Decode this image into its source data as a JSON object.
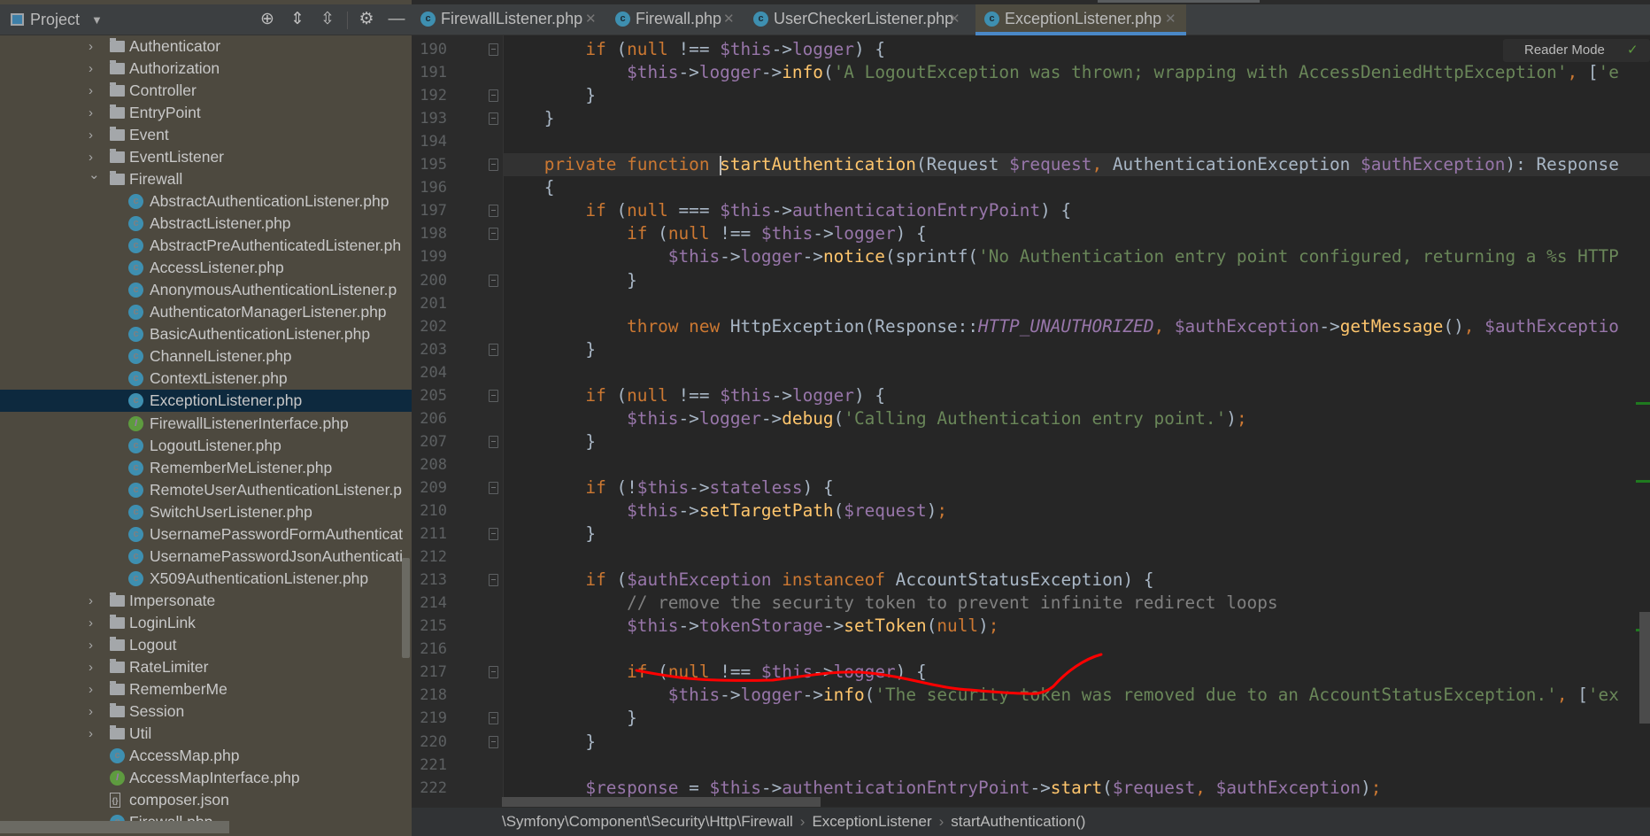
{
  "sidebar": {
    "title": "Project",
    "tree": [
      {
        "type": "folder",
        "open": false,
        "level": 1,
        "label": "Authenticator"
      },
      {
        "type": "folder",
        "open": false,
        "level": 1,
        "label": "Authorization"
      },
      {
        "type": "folder",
        "open": false,
        "level": 1,
        "label": "Controller"
      },
      {
        "type": "folder",
        "open": false,
        "level": 1,
        "label": "EntryPoint"
      },
      {
        "type": "folder",
        "open": false,
        "level": 1,
        "label": "Event"
      },
      {
        "type": "folder",
        "open": false,
        "level": 1,
        "label": "EventListener"
      },
      {
        "type": "folder",
        "open": true,
        "level": 1,
        "label": "Firewall"
      },
      {
        "type": "abstract",
        "level": 2,
        "label": "AbstractAuthenticationListener.php"
      },
      {
        "type": "abstract",
        "level": 2,
        "label": "AbstractListener.php"
      },
      {
        "type": "abstract",
        "level": 2,
        "label": "AbstractPreAuthenticatedListener.ph"
      },
      {
        "type": "class",
        "level": 2,
        "label": "AccessListener.php"
      },
      {
        "type": "class",
        "level": 2,
        "label": "AnonymousAuthenticationListener.p"
      },
      {
        "type": "class",
        "level": 2,
        "label": "AuthenticatorManagerListener.php"
      },
      {
        "type": "class",
        "level": 2,
        "label": "BasicAuthenticationListener.php"
      },
      {
        "type": "class",
        "level": 2,
        "label": "ChannelListener.php"
      },
      {
        "type": "class",
        "level": 2,
        "label": "ContextListener.php"
      },
      {
        "type": "class",
        "level": 2,
        "label": "ExceptionListener.php",
        "selected": true
      },
      {
        "type": "interface",
        "level": 2,
        "label": "FirewallListenerInterface.php"
      },
      {
        "type": "class",
        "level": 2,
        "label": "LogoutListener.php"
      },
      {
        "type": "class",
        "level": 2,
        "label": "RememberMeListener.php"
      },
      {
        "type": "class",
        "level": 2,
        "label": "RemoteUserAuthenticationListener.p"
      },
      {
        "type": "class",
        "level": 2,
        "label": "SwitchUserListener.php"
      },
      {
        "type": "class",
        "level": 2,
        "label": "UsernamePasswordFormAuthenticat"
      },
      {
        "type": "class",
        "level": 2,
        "label": "UsernamePasswordJsonAuthenticati"
      },
      {
        "type": "class",
        "level": 2,
        "label": "X509AuthenticationListener.php"
      },
      {
        "type": "folder",
        "open": false,
        "level": 1,
        "label": "Impersonate"
      },
      {
        "type": "folder",
        "open": false,
        "level": 1,
        "label": "LoginLink"
      },
      {
        "type": "folder",
        "open": false,
        "level": 1,
        "label": "Logout"
      },
      {
        "type": "folder",
        "open": false,
        "level": 1,
        "label": "RateLimiter"
      },
      {
        "type": "folder",
        "open": false,
        "level": 1,
        "label": "RememberMe"
      },
      {
        "type": "folder",
        "open": false,
        "level": 1,
        "label": "Session"
      },
      {
        "type": "folder",
        "open": false,
        "level": 1,
        "label": "Util"
      },
      {
        "type": "class",
        "level": 1,
        "label": "AccessMap.php"
      },
      {
        "type": "interface",
        "level": 1,
        "label": "AccessMapInterface.php"
      },
      {
        "type": "json",
        "level": 1,
        "label": "composer.json"
      },
      {
        "type": "class",
        "level": 1,
        "label": "Firewall.php"
      }
    ]
  },
  "tabs": [
    {
      "label": "FirewallListener.php",
      "active": false
    },
    {
      "label": "Firewall.php",
      "active": false
    },
    {
      "label": "UserCheckerListener.php",
      "active": false
    },
    {
      "label": "ExceptionListener.php",
      "active": true
    }
  ],
  "editor": {
    "reader_mode": "Reader Mode",
    "current_line": 195,
    "lines": [
      {
        "n": "190",
        "fold": "open",
        "t": [
          [
            "d",
            "        "
          ],
          [
            "k",
            "if"
          ],
          [
            "d",
            " ("
          ],
          [
            "k",
            "null"
          ],
          [
            "d",
            " !== "
          ],
          [
            "v",
            "$this"
          ],
          [
            "d",
            "->"
          ],
          [
            "v",
            "logger"
          ],
          [
            "d",
            ") {"
          ]
        ]
      },
      {
        "n": "191",
        "t": [
          [
            "d",
            "            "
          ],
          [
            "v",
            "$this"
          ],
          [
            "d",
            "->"
          ],
          [
            "v",
            "logger"
          ],
          [
            "d",
            "->"
          ],
          [
            "m",
            "info"
          ],
          [
            "d",
            "("
          ],
          [
            "s",
            "'A LogoutException was thrown; wrapping with AccessDeniedHttpException'"
          ],
          [
            "k",
            ","
          ],
          [
            "d",
            " ["
          ],
          [
            "s",
            "'e"
          ]
        ]
      },
      {
        "n": "192",
        "fold": "close",
        "t": [
          [
            "d",
            "        }"
          ]
        ]
      },
      {
        "n": "193",
        "fold": "close",
        "t": [
          [
            "d",
            "    }"
          ]
        ]
      },
      {
        "n": "194",
        "t": []
      },
      {
        "n": "195",
        "fold": "open",
        "t": [
          [
            "d",
            "    "
          ],
          [
            "k",
            "private function "
          ],
          [
            "caret",
            ""
          ],
          [
            "m",
            "startAuthentication"
          ],
          [
            "d",
            "(Request "
          ],
          [
            "v",
            "$request"
          ],
          [
            "k",
            ","
          ],
          [
            "d",
            " AuthenticationException "
          ],
          [
            "v",
            "$authException"
          ],
          [
            "d",
            "): Response"
          ]
        ]
      },
      {
        "n": "196",
        "t": [
          [
            "d",
            "    {"
          ]
        ]
      },
      {
        "n": "197",
        "fold": "open",
        "t": [
          [
            "d",
            "        "
          ],
          [
            "k",
            "if"
          ],
          [
            "d",
            " ("
          ],
          [
            "k",
            "null"
          ],
          [
            "d",
            " === "
          ],
          [
            "v",
            "$this"
          ],
          [
            "d",
            "->"
          ],
          [
            "v",
            "authenticationEntryPoint"
          ],
          [
            "d",
            ") {"
          ]
        ]
      },
      {
        "n": "198",
        "fold": "open",
        "t": [
          [
            "d",
            "            "
          ],
          [
            "k",
            "if"
          ],
          [
            "d",
            " ("
          ],
          [
            "k",
            "null"
          ],
          [
            "d",
            " !== "
          ],
          [
            "v",
            "$this"
          ],
          [
            "d",
            "->"
          ],
          [
            "v",
            "logger"
          ],
          [
            "d",
            ") {"
          ]
        ]
      },
      {
        "n": "199",
        "t": [
          [
            "d",
            "                "
          ],
          [
            "v",
            "$this"
          ],
          [
            "d",
            "->"
          ],
          [
            "v",
            "logger"
          ],
          [
            "d",
            "->"
          ],
          [
            "m",
            "notice"
          ],
          [
            "d",
            "(sprintf("
          ],
          [
            "s",
            "'No Authentication entry point configured, returning a %s HTTP"
          ]
        ]
      },
      {
        "n": "200",
        "fold": "close",
        "t": [
          [
            "d",
            "            }"
          ]
        ]
      },
      {
        "n": "201",
        "t": []
      },
      {
        "n": "202",
        "t": [
          [
            "d",
            "            "
          ],
          [
            "k",
            "throw new "
          ],
          [
            "d",
            "HttpException(Response::"
          ],
          [
            "i",
            "HTTP_UNAUTHORIZED"
          ],
          [
            "k",
            ","
          ],
          [
            "d",
            " "
          ],
          [
            "v",
            "$authException"
          ],
          [
            "d",
            "->"
          ],
          [
            "m",
            "getMessage"
          ],
          [
            "d",
            "()"
          ],
          [
            "k",
            ","
          ],
          [
            "d",
            " "
          ],
          [
            "v",
            "$authExceptio"
          ]
        ]
      },
      {
        "n": "203",
        "fold": "close",
        "t": [
          [
            "d",
            "        }"
          ]
        ]
      },
      {
        "n": "204",
        "t": []
      },
      {
        "n": "205",
        "fold": "open",
        "t": [
          [
            "d",
            "        "
          ],
          [
            "k",
            "if"
          ],
          [
            "d",
            " ("
          ],
          [
            "k",
            "null"
          ],
          [
            "d",
            " !== "
          ],
          [
            "v",
            "$this"
          ],
          [
            "d",
            "->"
          ],
          [
            "v",
            "logger"
          ],
          [
            "d",
            ") {"
          ]
        ]
      },
      {
        "n": "206",
        "t": [
          [
            "d",
            "            "
          ],
          [
            "v",
            "$this"
          ],
          [
            "d",
            "->"
          ],
          [
            "v",
            "logger"
          ],
          [
            "d",
            "->"
          ],
          [
            "m",
            "debug"
          ],
          [
            "d",
            "("
          ],
          [
            "s",
            "'Calling Authentication entry point.'"
          ],
          [
            "d",
            ")"
          ],
          [
            "k",
            ";"
          ]
        ]
      },
      {
        "n": "207",
        "fold": "close",
        "t": [
          [
            "d",
            "        }"
          ]
        ]
      },
      {
        "n": "208",
        "t": []
      },
      {
        "n": "209",
        "fold": "open",
        "t": [
          [
            "d",
            "        "
          ],
          [
            "k",
            "if"
          ],
          [
            "d",
            " (!"
          ],
          [
            "v",
            "$this"
          ],
          [
            "d",
            "->"
          ],
          [
            "v",
            "stateless"
          ],
          [
            "d",
            ") {"
          ]
        ]
      },
      {
        "n": "210",
        "t": [
          [
            "d",
            "            "
          ],
          [
            "v",
            "$this"
          ],
          [
            "d",
            "->"
          ],
          [
            "m",
            "setTargetPath"
          ],
          [
            "d",
            "("
          ],
          [
            "v",
            "$request"
          ],
          [
            "d",
            ")"
          ],
          [
            "k",
            ";"
          ]
        ]
      },
      {
        "n": "211",
        "fold": "close",
        "t": [
          [
            "d",
            "        }"
          ]
        ]
      },
      {
        "n": "212",
        "t": []
      },
      {
        "n": "213",
        "fold": "open",
        "t": [
          [
            "d",
            "        "
          ],
          [
            "k",
            "if"
          ],
          [
            "d",
            " ("
          ],
          [
            "v",
            "$authException"
          ],
          [
            "k",
            " instanceof "
          ],
          [
            "d",
            "AccountStatusException) {"
          ]
        ]
      },
      {
        "n": "214",
        "t": [
          [
            "d",
            "            "
          ],
          [
            "c",
            "// remove the security token to prevent infinite redirect loops"
          ]
        ]
      },
      {
        "n": "215",
        "t": [
          [
            "d",
            "            "
          ],
          [
            "v",
            "$this"
          ],
          [
            "d",
            "->"
          ],
          [
            "v",
            "tokenStorage"
          ],
          [
            "d",
            "->"
          ],
          [
            "m",
            "setToken"
          ],
          [
            "d",
            "("
          ],
          [
            "k",
            "null"
          ],
          [
            "d",
            ")"
          ],
          [
            "k",
            ";"
          ]
        ]
      },
      {
        "n": "216",
        "t": []
      },
      {
        "n": "217",
        "fold": "open",
        "t": [
          [
            "d",
            "            "
          ],
          [
            "k",
            "if"
          ],
          [
            "d",
            " ("
          ],
          [
            "k",
            "null"
          ],
          [
            "d",
            " !== "
          ],
          [
            "v",
            "$this"
          ],
          [
            "d",
            "->"
          ],
          [
            "v",
            "logger"
          ],
          [
            "d",
            ") {"
          ]
        ]
      },
      {
        "n": "218",
        "t": [
          [
            "d",
            "                "
          ],
          [
            "v",
            "$this"
          ],
          [
            "d",
            "->"
          ],
          [
            "v",
            "logger"
          ],
          [
            "d",
            "->"
          ],
          [
            "m",
            "info"
          ],
          [
            "d",
            "("
          ],
          [
            "s",
            "'The security token was removed due to an AccountStatusException.'"
          ],
          [
            "k",
            ","
          ],
          [
            "d",
            " ["
          ],
          [
            "s",
            "'ex"
          ]
        ]
      },
      {
        "n": "219",
        "fold": "close",
        "t": [
          [
            "d",
            "            }"
          ]
        ]
      },
      {
        "n": "220",
        "fold": "close",
        "t": [
          [
            "d",
            "        }"
          ]
        ]
      },
      {
        "n": "221",
        "t": []
      },
      {
        "n": "222",
        "t": [
          [
            "d",
            "        "
          ],
          [
            "v",
            "$response"
          ],
          [
            "d",
            " = "
          ],
          [
            "v",
            "$this"
          ],
          [
            "d",
            "->"
          ],
          [
            "v",
            "authenticationEntryPoint"
          ],
          [
            "d",
            "->"
          ],
          [
            "m",
            "start"
          ],
          [
            "d",
            "("
          ],
          [
            "v",
            "$request"
          ],
          [
            "k",
            ","
          ],
          [
            "d",
            " "
          ],
          [
            "v",
            "$authException"
          ],
          [
            "d",
            ")"
          ],
          [
            "k",
            ";"
          ]
        ]
      }
    ]
  },
  "breadcrumb": [
    "\\Symfony\\Component\\Security\\Http\\Firewall",
    "ExceptionListener",
    "startAuthentication()"
  ],
  "colors": {
    "accent": "#4a88c7",
    "selection": "#0d293e",
    "annotation": "#ff0000",
    "change_marker": "#1f7a1f"
  }
}
